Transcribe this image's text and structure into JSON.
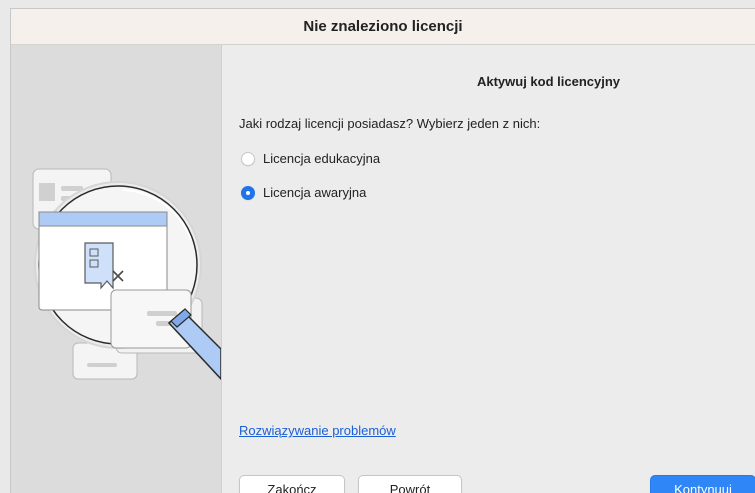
{
  "window": {
    "title": "Nie znaleziono licencji"
  },
  "main": {
    "heading": "Aktywuj kod licencyjny",
    "question": "Jaki rodzaj licencji posiadasz? Wybierz jeden z nich:",
    "options": [
      {
        "label": "Licencja edukacyjna",
        "selected": false
      },
      {
        "label": "Licencja awaryjna",
        "selected": true
      }
    ],
    "troubleshoot_link": "Rozwiązywanie problemów"
  },
  "buttons": {
    "quit": "Zakończ",
    "back": "Powrót",
    "continue": "Kontynuuj"
  },
  "colors": {
    "accent": "#2f86f6",
    "link": "#1a5fd6",
    "illustration_blue": "#aecbf5"
  },
  "icons": [
    "magnifier-illustration",
    "document-icon",
    "license-card-icon"
  ]
}
